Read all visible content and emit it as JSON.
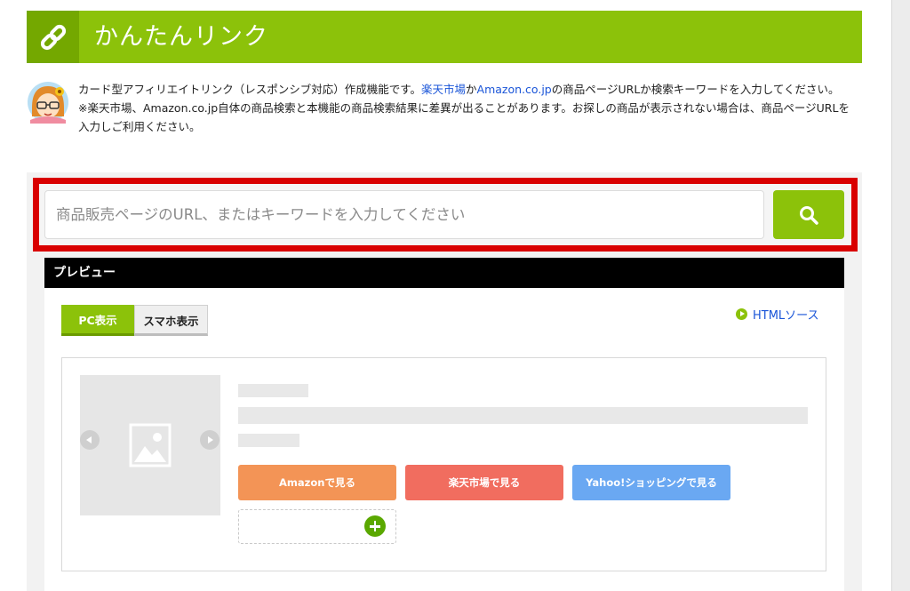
{
  "header": {
    "title": "かんたんリンク",
    "icon": "link-chain-icon"
  },
  "intro": {
    "line1_prefix": "カード型アフィリエイトリンク（レスポンシブ対応）作成機能です。",
    "rakuten_link": "楽天市場",
    "connector": "か",
    "amazon_link": "Amazon.co.jp",
    "line1_suffix": "の商品ページURLか検索キーワードを入力してください。",
    "note": "※楽天市場、Amazon.co.jp自体の商品検索と本機能の商品検索結果に差異が出ることがあります。お探しの商品が表示されない場合は、商品ページURLを入力しご利用ください。"
  },
  "search": {
    "placeholder": "商品販売ページのURL、またはキーワードを入力してください",
    "value": "",
    "button_icon": "search-icon"
  },
  "preview": {
    "title": "プレビュー",
    "tabs": [
      {
        "label": "PC表示",
        "active": true
      },
      {
        "label": "スマホ表示",
        "active": false
      }
    ],
    "html_source_link": "HTMLソース",
    "shop_buttons": [
      {
        "label": "Amazonで見る",
        "color": "#f39456"
      },
      {
        "label": "楽天市場で見る",
        "color": "#f16d5f"
      },
      {
        "label": "Yahoo!ショッピングで見る",
        "color": "#6aa8f2"
      }
    ]
  },
  "colors": {
    "brand_green": "#8cc20a",
    "highlight_red": "#d90000",
    "link_blue": "#1a55d8"
  }
}
